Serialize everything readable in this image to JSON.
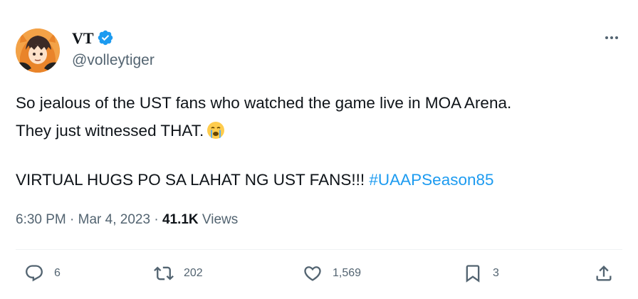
{
  "user": {
    "display_name": "VT",
    "handle": "@volleytiger"
  },
  "tweet": {
    "line1": "So jealous of the UST fans who watched the game live in MOA Arena.",
    "line2": "They just witnessed THAT.",
    "line3": "VIRTUAL HUGS PO SA LAHAT NG UST FANS!!! ",
    "hashtag": "#UAAPSeason85"
  },
  "meta": {
    "time": "6:30 PM",
    "separator1": " · ",
    "date": "Mar 4, 2023",
    "separator2": " · ",
    "views_count": "41.1K",
    "views_label": " Views"
  },
  "actions": {
    "replies": "6",
    "retweets": "202",
    "likes": "1,569",
    "bookmarks": "3"
  },
  "colors": {
    "accent": "#1d9bf0",
    "text": "#0f1419",
    "secondary": "#536471",
    "divider": "#eff3f4"
  },
  "icons": [
    "avatar",
    "verified-badge-icon",
    "more-options-icon",
    "loudly-crying-emoji",
    "reply-icon",
    "retweet-icon",
    "like-icon",
    "bookmark-icon",
    "share-icon"
  ]
}
